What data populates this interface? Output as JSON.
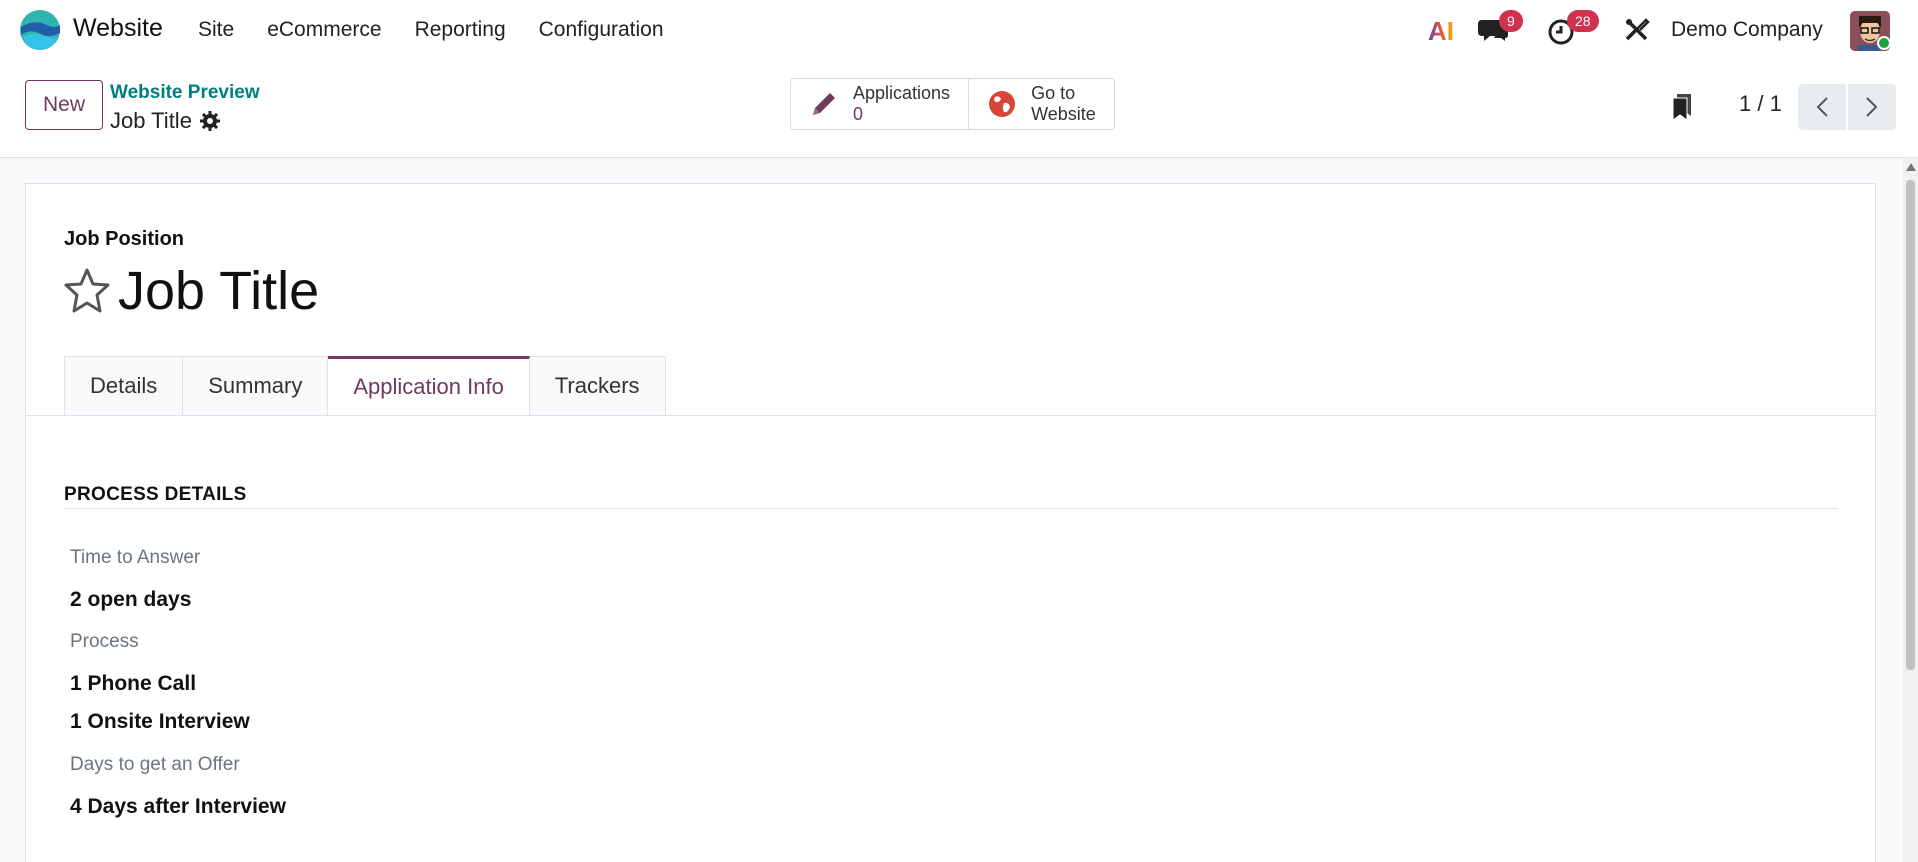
{
  "navbar": {
    "app_name": "Website",
    "menu": [
      "Site",
      "eCommerce",
      "Reporting",
      "Configuration"
    ],
    "ai_label": "AI",
    "messages_count": "9",
    "activities_count": "28",
    "company": "Demo Company",
    "colors": {
      "brand_purple": "#71395f",
      "badge_red": "#d0314f",
      "teal": "#017e84"
    }
  },
  "control_panel": {
    "new_label": "New",
    "breadcrumb": "Website Preview",
    "record_title": "Job Title",
    "smart_buttons": {
      "applications_label": "Applications",
      "applications_count": "0",
      "website_label_1": "Go to",
      "website_label_2": "Website"
    },
    "pager": "1 / 1"
  },
  "form": {
    "label": "Job Position",
    "title": "Job Title",
    "tabs": [
      "Details",
      "Summary",
      "Application Info",
      "Trackers"
    ],
    "active_tab": "Application Info",
    "section_title": "PROCESS DETAILS",
    "fields": {
      "time_to_answer_label": "Time to Answer",
      "time_to_answer_value": "2 open days",
      "process_label": "Process",
      "process_value_1": "1 Phone Call",
      "process_value_2": "1 Onsite Interview",
      "days_offer_label": "Days to get an Offer",
      "days_offer_value": "4 Days after Interview"
    }
  }
}
